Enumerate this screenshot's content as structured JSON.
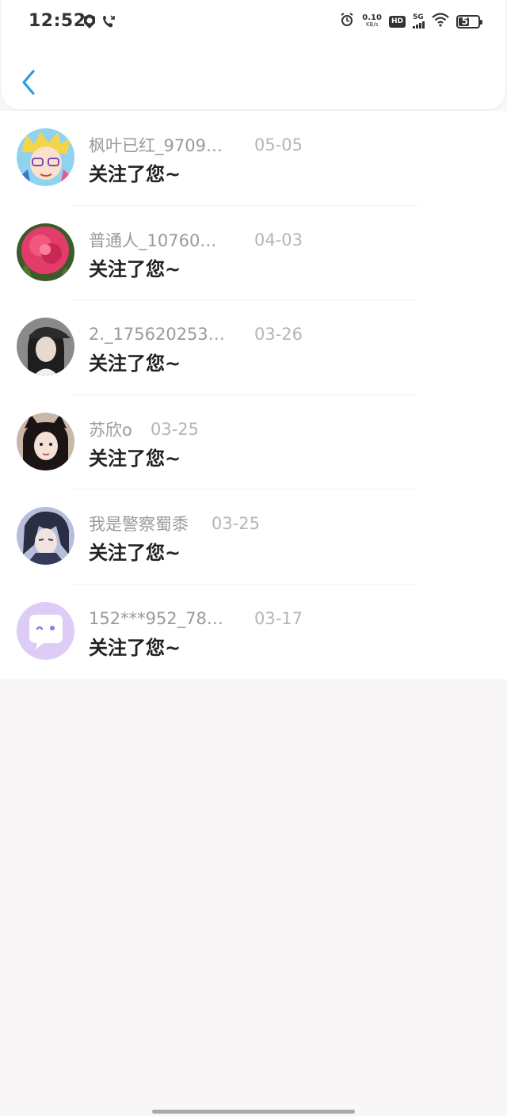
{
  "status_bar": {
    "time": "12:52",
    "net_speed_value": "0.10",
    "net_speed_unit": "KB/s",
    "hd_label": "HD",
    "signal_label": "5G",
    "battery_level": "55"
  },
  "nav": {
    "back_icon": "chevron-left-icon",
    "accent_color": "#2b9be8"
  },
  "followers": [
    {
      "nickname": "枫叶已红_9709…",
      "date": "05-05",
      "message": "关注了您~",
      "avatar": "anime-blond-boy-avatar"
    },
    {
      "nickname": "普通人_10760…",
      "date": "04-03",
      "message": "关注了您~",
      "avatar": "pink-flower-avatar"
    },
    {
      "nickname": "2._175620253…",
      "date": "03-26",
      "message": "关注了您~",
      "avatar": "girl-with-cap-avatar"
    },
    {
      "nickname": "苏欣o",
      "date": "03-25",
      "message": "关注了您~",
      "avatar": "girl-cat-ears-avatar"
    },
    {
      "nickname": "我是警察蜀黍",
      "date": "03-25",
      "message": "关注了您~",
      "avatar": "anime-dark-hair-avatar"
    },
    {
      "nickname": "152***952_78…",
      "date": "03-17",
      "message": "关注了您~",
      "avatar": "default-chat-bubble-avatar"
    }
  ]
}
